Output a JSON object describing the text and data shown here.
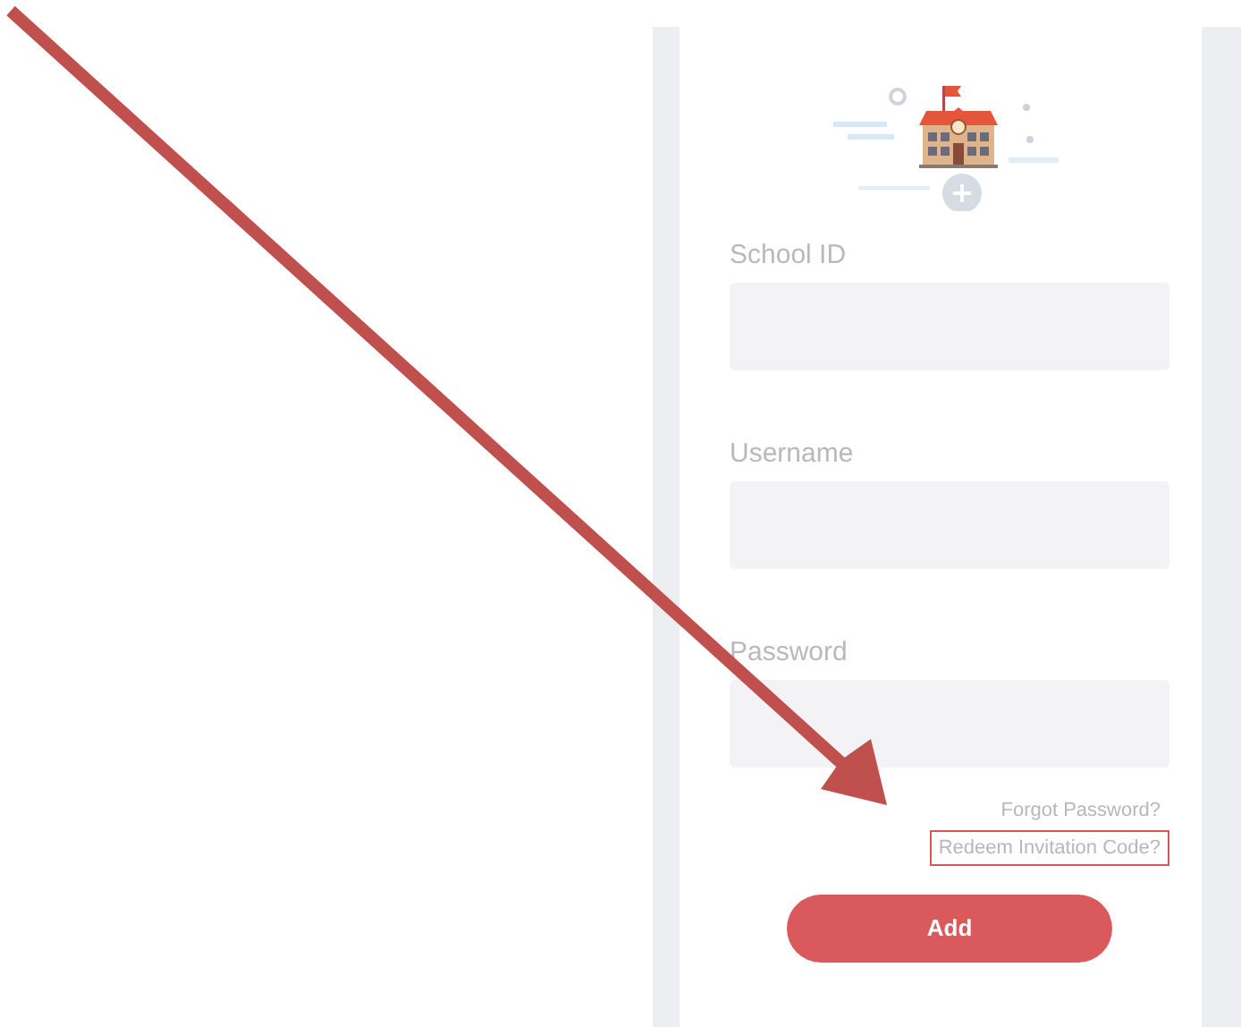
{
  "form": {
    "fields": [
      {
        "label": "School ID"
      },
      {
        "label": "Username"
      },
      {
        "label": "Password"
      }
    ],
    "links": [
      {
        "text": "Forgot Password?",
        "highlighted": false
      },
      {
        "text": "Redeem Invitation Code?",
        "highlighted": true
      }
    ],
    "button": "Add"
  }
}
